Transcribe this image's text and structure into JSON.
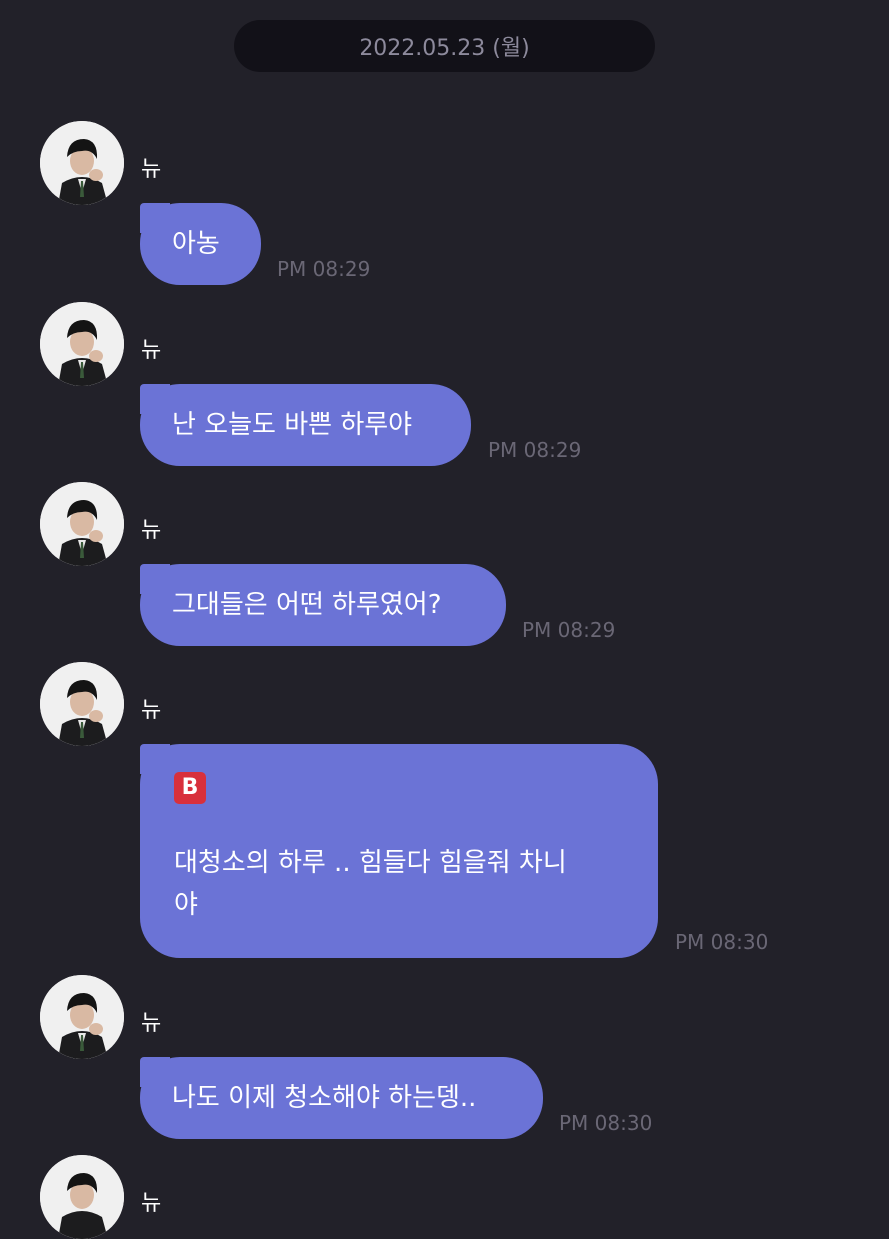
{
  "date_divider": "2022.05.23 (월)",
  "sender_name": "뉴",
  "messages": [
    {
      "text": "아농",
      "time": "PM 08:29"
    },
    {
      "text": "난 오늘도 바쁜 하루야",
      "time": "PM 08:29"
    },
    {
      "text": "그대들은 어떤 하루였어?",
      "time": "PM 08:29"
    },
    {
      "badge": "B",
      "line1": "대청소의 하루 .. 힘들다 힘을줘 차니",
      "line2": "야",
      "time": "PM 08:30"
    },
    {
      "text": "나도 이제 청소해야 하는뎅..",
      "time": "PM 08:30"
    }
  ],
  "colors": {
    "background": "#222129",
    "bubble": "#6b73d6",
    "date_pill": "#121118",
    "timestamp": "#6a6775",
    "badge": "#d8303c"
  }
}
